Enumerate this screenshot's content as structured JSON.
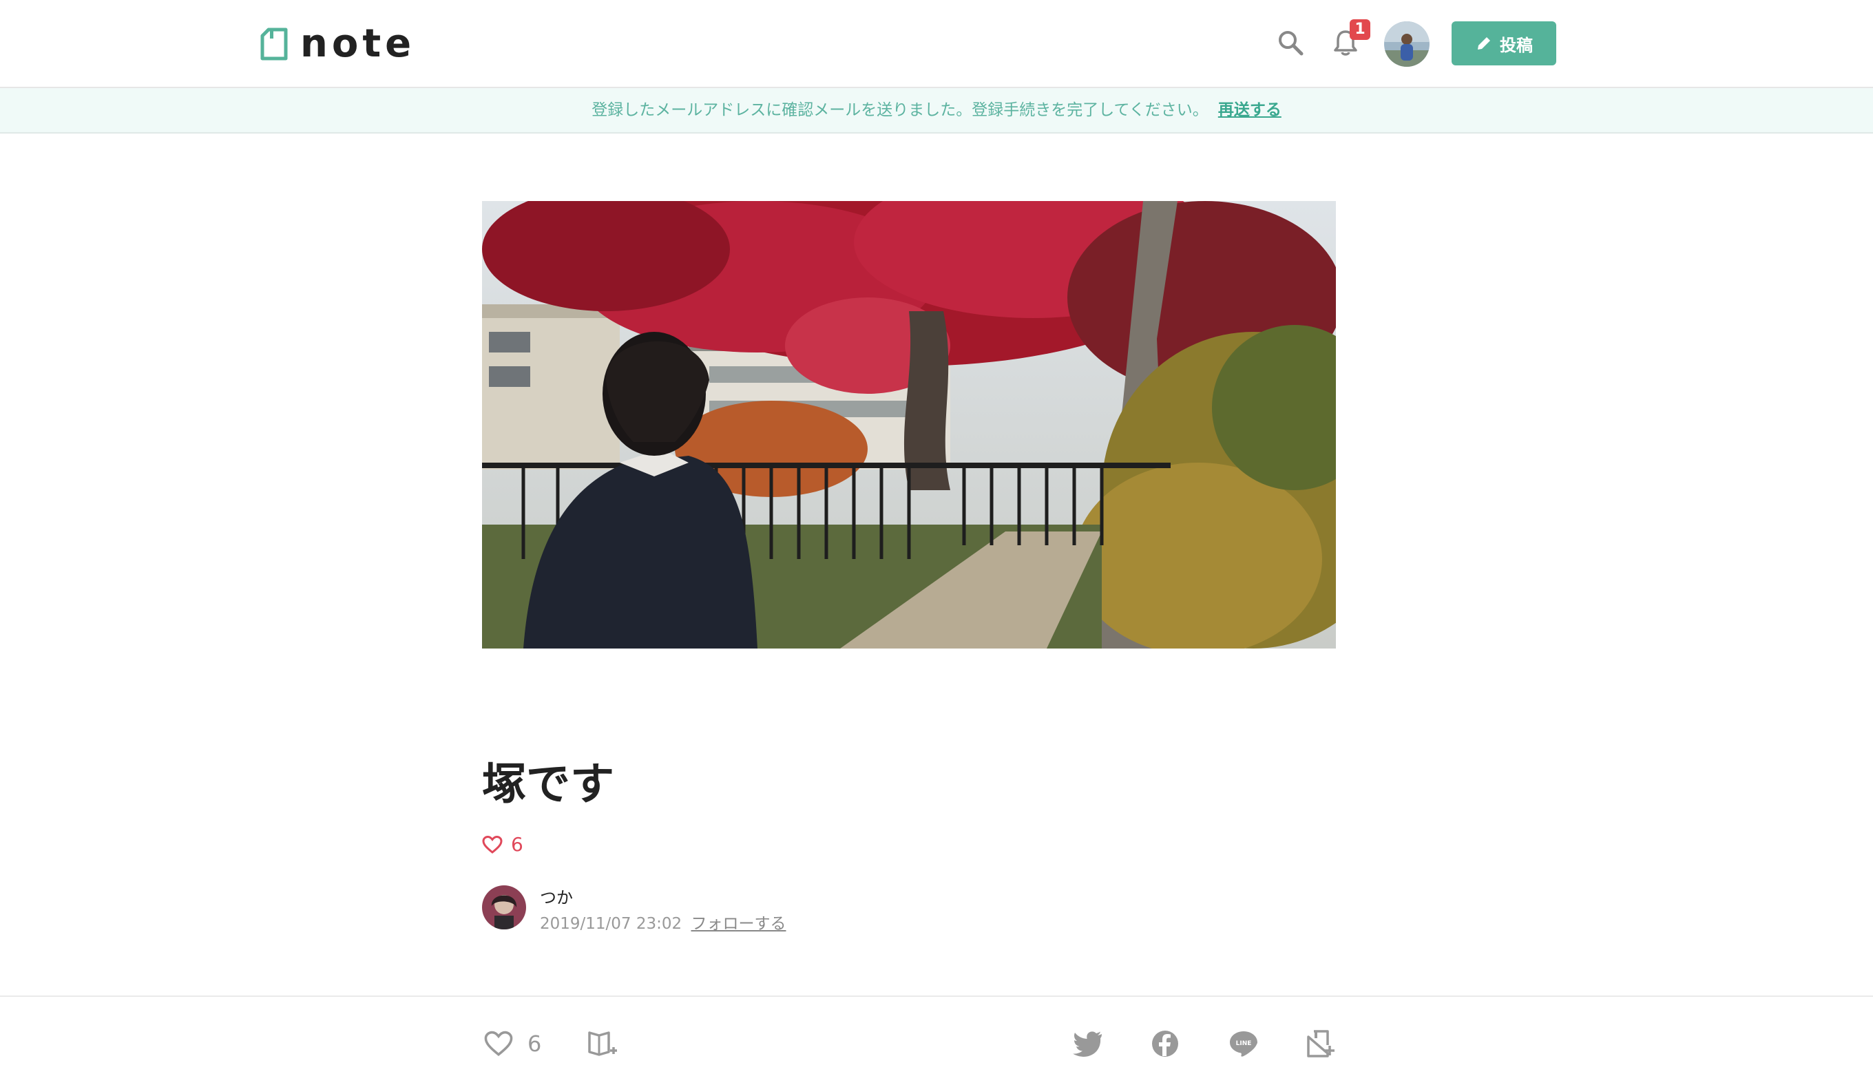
{
  "header": {
    "logo_text": "note",
    "notification_count": "1",
    "post_label": "投稿"
  },
  "notice": {
    "message": "登録したメールアドレスに確認メールを送りました。登録手続きを完了してください。",
    "resend_label": "再送する"
  },
  "article": {
    "title": "塚です",
    "like_count": "6",
    "author_name": "つか",
    "date": "2019/11/07 23:02",
    "follow_label": "フォローする"
  },
  "bottom_bar": {
    "like_count": "6",
    "icons": [
      "heart-icon",
      "magazine-add-icon",
      "twitter-icon",
      "facebook-icon",
      "line-icon",
      "embed-icon"
    ]
  },
  "colors": {
    "brand": "#55b39a",
    "notice_bg": "#f0faf8",
    "notice_text": "#5cb3a0",
    "like": "#e0485a",
    "badge": "#e2484d"
  }
}
